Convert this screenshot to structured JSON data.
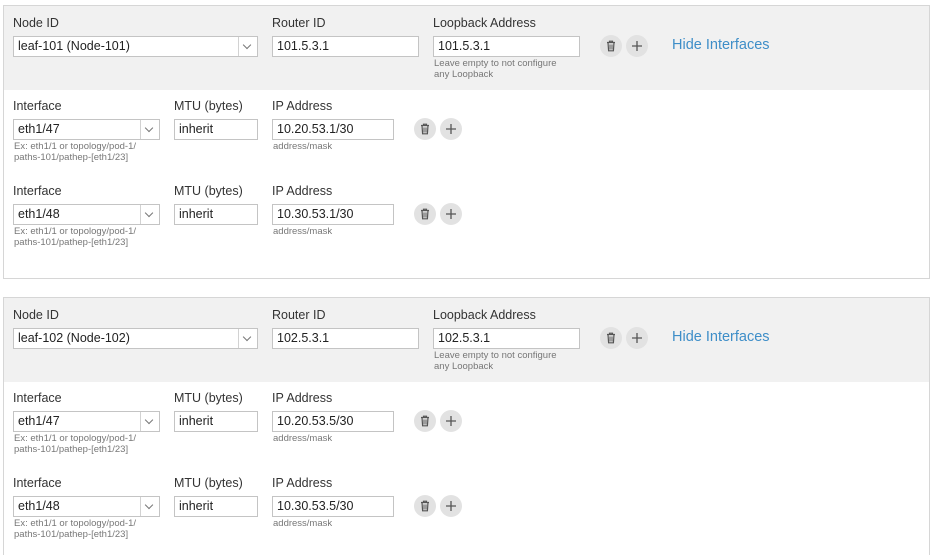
{
  "labels": {
    "node_id": "Node ID",
    "router_id": "Router ID",
    "loopback_address": "Loopback Address",
    "interface": "Interface",
    "mtu": "MTU (bytes)",
    "ip_address": "IP Address"
  },
  "hints": {
    "loopback_line1": "Leave empty to not configure",
    "loopback_line2": "any Loopback",
    "interface_line1": "Ex: eth1/1 or topology/pod-1/",
    "interface_line2": "paths-101/pathep-[eth1/23]",
    "ip": "address/mask"
  },
  "nodes": [
    {
      "node_id": "leaf-101 (Node-101)",
      "router_id": "101.5.3.1",
      "loopback": "101.5.3.1",
      "toggle_label": "Hide Interfaces",
      "interfaces": [
        {
          "interface": "eth1/47",
          "mtu": "inherit",
          "ip": "10.20.53.1/30"
        },
        {
          "interface": "eth1/48",
          "mtu": "inherit",
          "ip": "10.30.53.1/30"
        }
      ]
    },
    {
      "node_id": "leaf-102 (Node-102)",
      "router_id": "102.5.3.1",
      "loopback": "102.5.3.1",
      "toggle_label": "Hide Interfaces",
      "interfaces": [
        {
          "interface": "eth1/47",
          "mtu": "inherit",
          "ip": "10.20.53.5/30"
        },
        {
          "interface": "eth1/48",
          "mtu": "inherit",
          "ip": "10.30.53.5/30"
        }
      ]
    }
  ],
  "icons": {
    "delete": "trash-icon",
    "add": "plus-icon"
  },
  "colors": {
    "link": "#3e8ec8",
    "header_bg": "#f1f1f1",
    "icon_bg": "#e2e2e2"
  }
}
